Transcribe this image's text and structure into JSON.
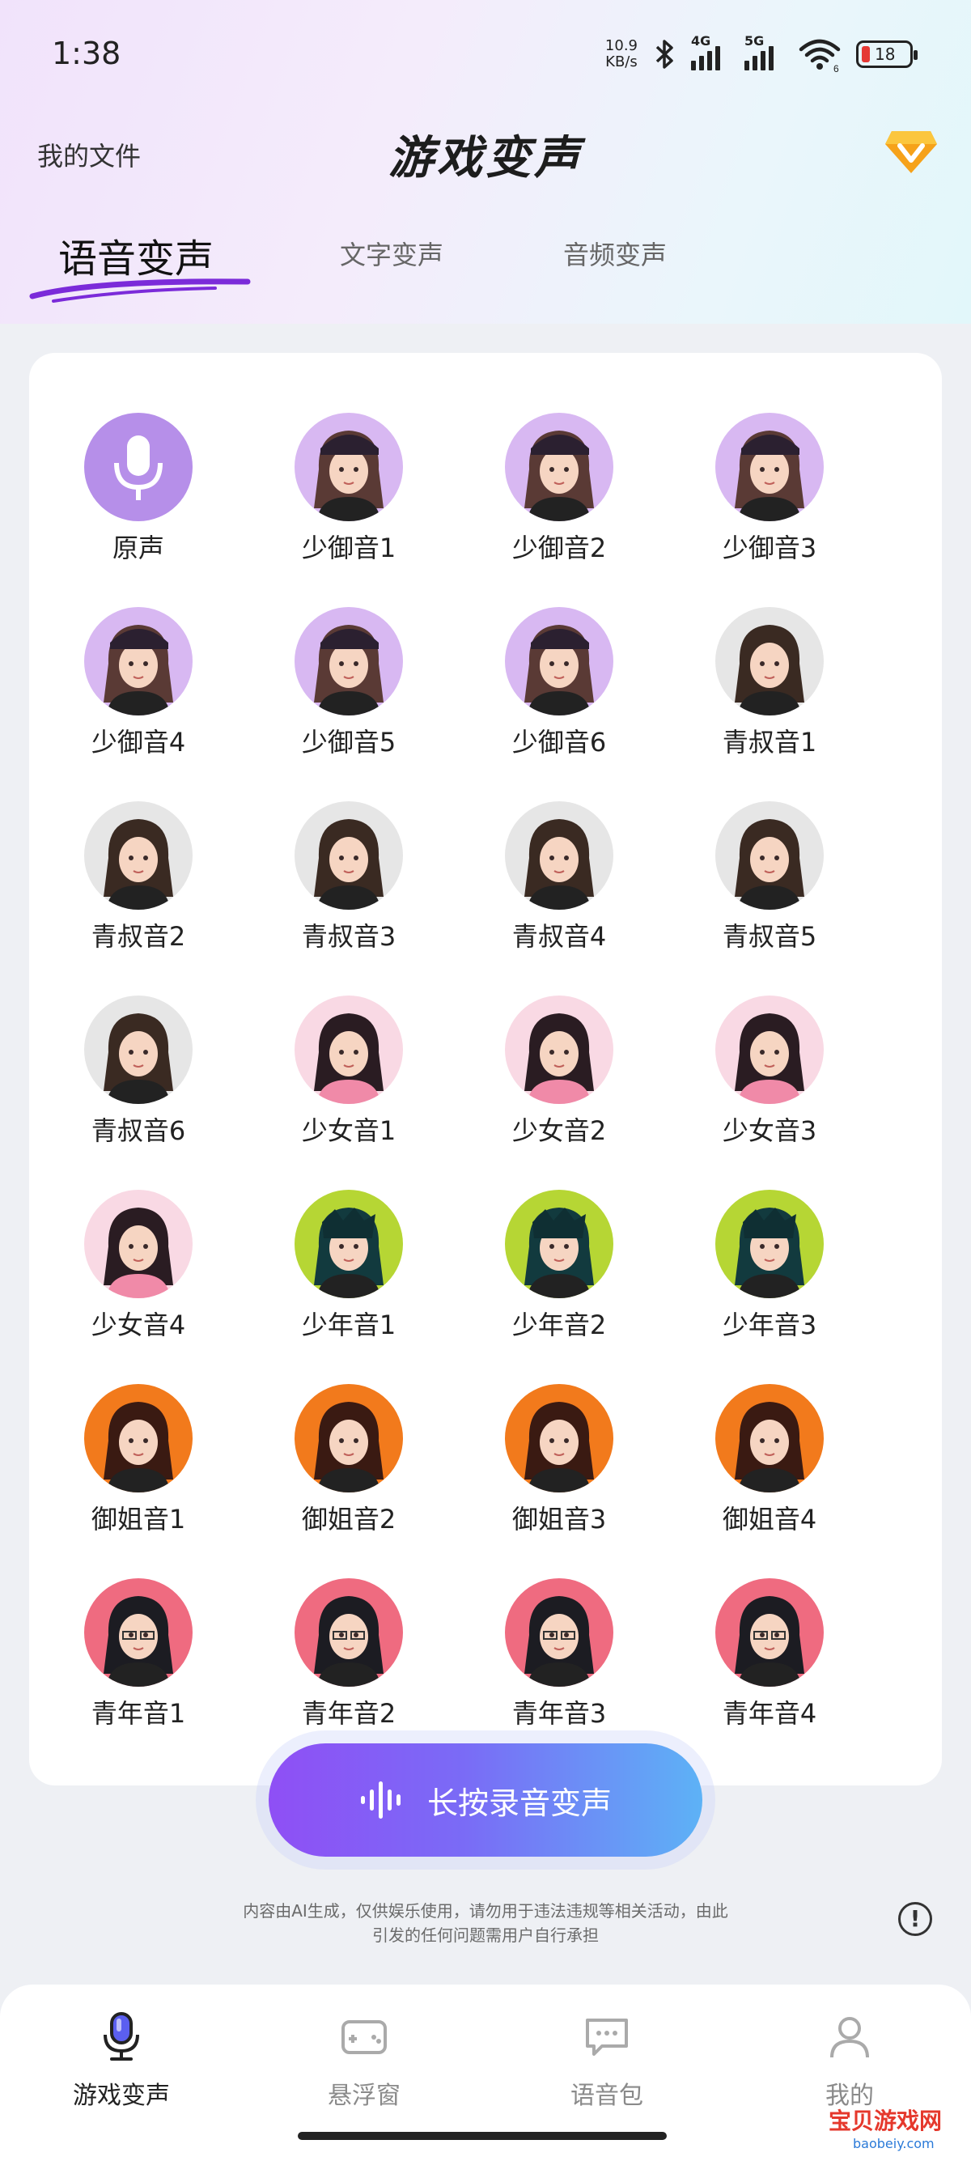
{
  "status_bar": {
    "time": "1:38",
    "net_speed_top": "10.9",
    "net_speed_unit": "KB/s",
    "sig1_label": "4G",
    "sig2_label": "5G",
    "wifi_sub": "6",
    "battery": "18"
  },
  "header": {
    "my_files": "我的文件",
    "title": "游戏变声",
    "vip_icon": "diamond-v-icon"
  },
  "tabs": [
    {
      "label": "语音变声",
      "active": true
    },
    {
      "label": "文字变声",
      "active": false
    },
    {
      "label": "音频变声",
      "active": false
    }
  ],
  "voices": [
    {
      "label": "原声",
      "kind": "mic"
    },
    {
      "label": "少御音1",
      "kind": "girl-cap"
    },
    {
      "label": "少御音2",
      "kind": "girl-cap"
    },
    {
      "label": "少御音3",
      "kind": "girl-cap"
    },
    {
      "label": "少御音4",
      "kind": "girl-cap"
    },
    {
      "label": "少御音5",
      "kind": "girl-cap"
    },
    {
      "label": "少御音6",
      "kind": "girl-cap"
    },
    {
      "label": "青叔音1",
      "kind": "uncle"
    },
    {
      "label": "青叔音2",
      "kind": "uncle"
    },
    {
      "label": "青叔音3",
      "kind": "uncle"
    },
    {
      "label": "青叔音4",
      "kind": "uncle"
    },
    {
      "label": "青叔音5",
      "kind": "uncle"
    },
    {
      "label": "青叔音6",
      "kind": "uncle"
    },
    {
      "label": "少女音1",
      "kind": "girl-pink"
    },
    {
      "label": "少女音2",
      "kind": "girl-pink"
    },
    {
      "label": "少女音3",
      "kind": "girl-pink"
    },
    {
      "label": "少女音4",
      "kind": "girl-pink"
    },
    {
      "label": "少年音1",
      "kind": "boy-green"
    },
    {
      "label": "少年音2",
      "kind": "boy-green"
    },
    {
      "label": "少年音3",
      "kind": "boy-green"
    },
    {
      "label": "御姐音1",
      "kind": "lady-orange"
    },
    {
      "label": "御姐音2",
      "kind": "lady-orange"
    },
    {
      "label": "御姐音3",
      "kind": "lady-orange"
    },
    {
      "label": "御姐音4",
      "kind": "lady-orange"
    },
    {
      "label": "青年音1",
      "kind": "man-red"
    },
    {
      "label": "青年音2",
      "kind": "man-red"
    },
    {
      "label": "青年音3",
      "kind": "man-red"
    },
    {
      "label": "青年音4",
      "kind": "man-red"
    }
  ],
  "record_button": {
    "label": "长按录音变声",
    "icon": "waveform-icon"
  },
  "disclaimer": {
    "line1": "内容由AI生成，仅供娱乐使用，请勿用于违法违规等相关活动，由此",
    "line2": "引发的任何问题需用户自行承担"
  },
  "info_icon": "!",
  "bottom_nav": [
    {
      "label": "游戏变声",
      "icon": "microphone-icon",
      "active": true
    },
    {
      "label": "悬浮窗",
      "icon": "gamepad-icon",
      "active": false
    },
    {
      "label": "语音包",
      "icon": "chat-bubble-icon",
      "active": false
    },
    {
      "label": "我的",
      "icon": "person-icon",
      "active": false
    }
  ],
  "watermark": {
    "title": "宝贝游戏网",
    "url": "baobeiy.com"
  },
  "colors": {
    "accent": "#8f4ff5",
    "mic_circle": "#b68fe9",
    "girl_cap_bg": "#d8b8f2",
    "uncle_bg": "#e6e6e6",
    "girl_pink_bg": "#f9d9e4",
    "boy_green_bg": "#b6d634",
    "lady_orange_bg": "#f27a1c",
    "man_red_bg": "#ef6b80"
  }
}
